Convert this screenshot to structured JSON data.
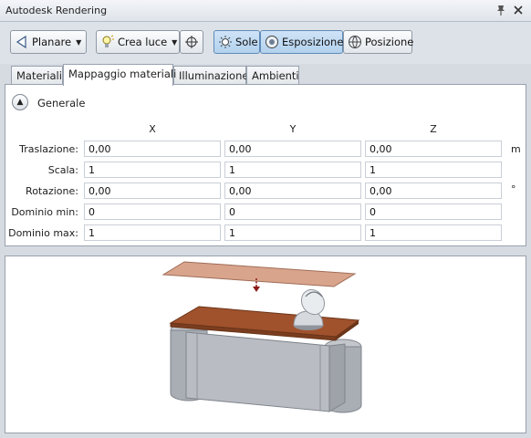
{
  "window": {
    "title": "Autodesk Rendering"
  },
  "toolbar": {
    "planar_label": "Planare",
    "create_light_label": "Crea luce",
    "sun_label": "Sole",
    "exposure_label": "Esposizione",
    "location_label": "Posizione"
  },
  "tabs": [
    {
      "label": "Materiali"
    },
    {
      "label": "Mappaggio materiali"
    },
    {
      "label": "Illuminazione"
    },
    {
      "label": "Ambienti"
    }
  ],
  "section": {
    "title": "Generale"
  },
  "columns": [
    "X",
    "Y",
    "Z"
  ],
  "rows": [
    {
      "label": "Traslazione:",
      "values": [
        "0,00",
        "0,00",
        "0,00"
      ],
      "unit": "m"
    },
    {
      "label": "Scala:",
      "values": [
        "1",
        "1",
        "1"
      ],
      "unit": ""
    },
    {
      "label": "Rotazione:",
      "values": [
        "0,00",
        "0,00",
        "0,00"
      ],
      "unit": "°"
    },
    {
      "label": "Dominio min:",
      "values": [
        "0",
        "0",
        "0"
      ],
      "unit": ""
    },
    {
      "label": "Dominio max:",
      "values": [
        "1",
        "1",
        "1"
      ],
      "unit": ""
    }
  ],
  "colors": {
    "plane_texture": "#d9a48c",
    "tabletop": "#a0522d",
    "base_gray": "#b9bcc2",
    "pressed_button": "#b3d2ee"
  },
  "icons": [
    "pin-icon",
    "close-icon",
    "planar-map-icon",
    "light-bulb-icon",
    "target-icon",
    "sun-icon",
    "exposure-icon",
    "globe-icon",
    "collapse-icon"
  ]
}
